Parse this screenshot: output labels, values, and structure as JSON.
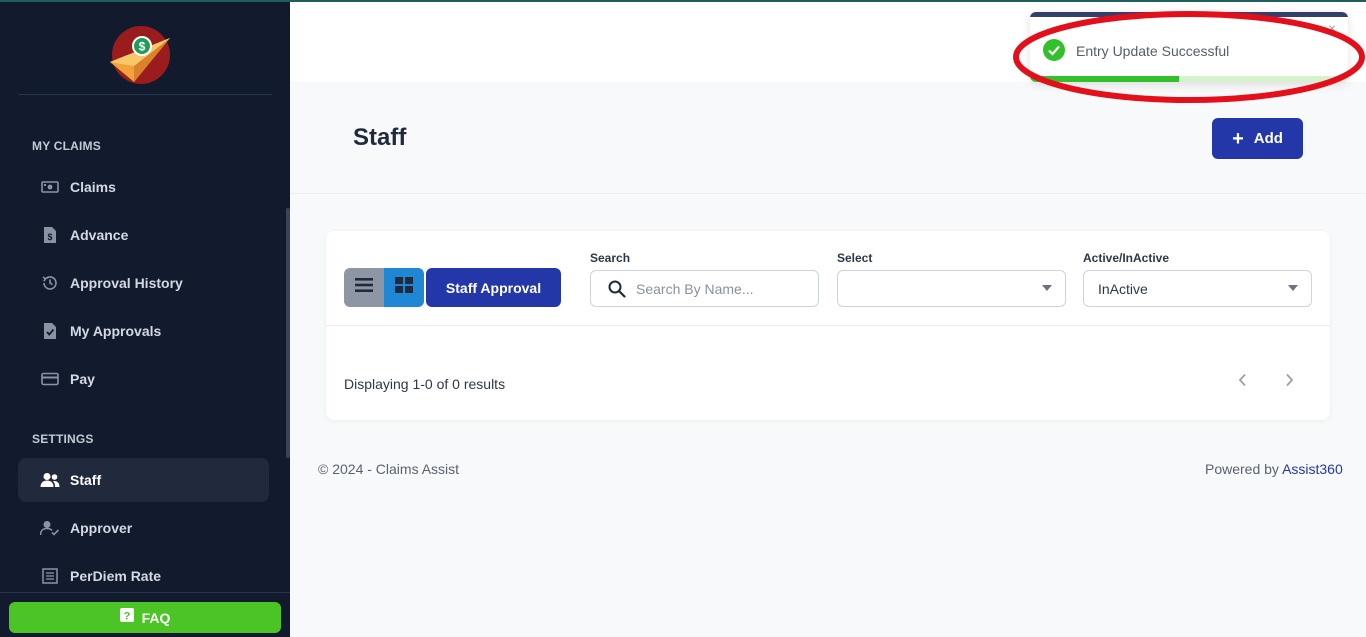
{
  "sidebar": {
    "sections": [
      {
        "title": "MY CLAIMS",
        "items": [
          {
            "label": "Claims",
            "icon": "money-icon"
          },
          {
            "label": "Advance",
            "icon": "invoice-icon"
          },
          {
            "label": "Approval History",
            "icon": "history-icon"
          },
          {
            "label": "My Approvals",
            "icon": "document-check-icon"
          },
          {
            "label": "Pay",
            "icon": "credit-card-icon"
          }
        ]
      },
      {
        "title": "SETTINGS",
        "items": [
          {
            "label": "Staff",
            "icon": "users-icon",
            "active": true
          },
          {
            "label": "Approver",
            "icon": "user-check-icon"
          },
          {
            "label": "PerDiem Rate",
            "icon": "table-icon"
          }
        ]
      }
    ],
    "faq_label": "FAQ"
  },
  "page": {
    "title": "Staff",
    "add_label": "Add"
  },
  "filters": {
    "staff_approval_label": "Staff Approval",
    "search_label": "Search",
    "search_placeholder": "Search By Name...",
    "select_label": "Select",
    "select_value": "",
    "status_label": "Active/InActive",
    "status_value": "InActive"
  },
  "results": {
    "text": "Displaying 1-0 of 0 results"
  },
  "footer": {
    "copyright": "© 2024 - Claims Assist",
    "powered_by": "Powered by",
    "powered_link": "Assist360"
  },
  "toast": {
    "message": "Entry Update Successful",
    "close_glyph": "×",
    "progress": 0.47
  },
  "colors": {
    "sidebar_bg": "#121b2e",
    "primary": "#2337a8",
    "faq_green": "#4cc426",
    "success_green": "#32c02b",
    "annotation_red": "#e3101c"
  }
}
